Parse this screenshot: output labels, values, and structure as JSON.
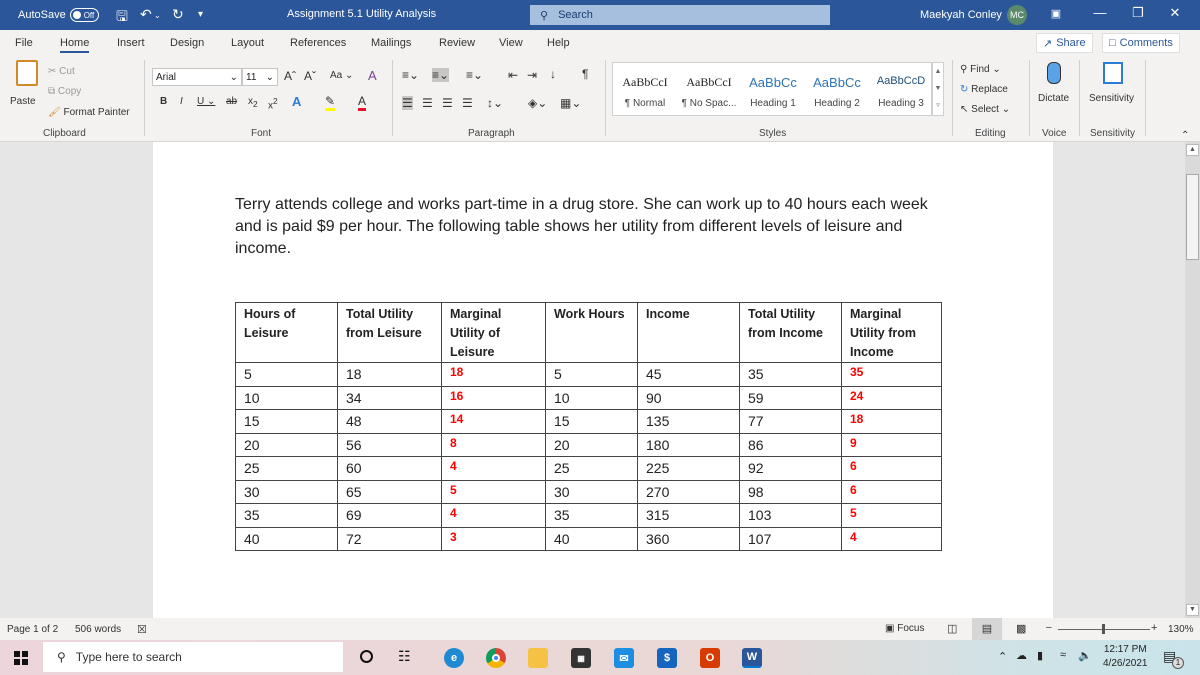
{
  "titlebar": {
    "autosave_label": "AutoSave",
    "autosave_state": "Off",
    "doc_title": "Assignment 5.1 Utility Analysis",
    "search_placeholder": "Search",
    "user_name": "Maekyah Conley",
    "user_initials": "MC"
  },
  "menu": {
    "tabs": [
      "File",
      "Home",
      "Insert",
      "Design",
      "Layout",
      "References",
      "Mailings",
      "Review",
      "View",
      "Help"
    ],
    "active": "Home",
    "share_label": "Share",
    "comments_label": "Comments"
  },
  "ribbon": {
    "clipboard": {
      "paste": "Paste",
      "cut": "Cut",
      "copy": "Copy",
      "format_painter": "Format Painter",
      "group": "Clipboard"
    },
    "font": {
      "family": "Arial",
      "size": "11",
      "case_btn": "Aa",
      "group": "Font"
    },
    "paragraph": {
      "group": "Paragraph"
    },
    "styles": {
      "items": [
        {
          "sample": "AaBbCcI",
          "name": "¶ Normal"
        },
        {
          "sample": "AaBbCcI",
          "name": "¶ No Spac..."
        },
        {
          "sample": "AaBbCc",
          "name": "Heading 1"
        },
        {
          "sample": "AaBbCc",
          "name": "Heading 2"
        },
        {
          "sample": "AaBbCcD",
          "name": "Heading 3"
        }
      ],
      "group": "Styles"
    },
    "editing": {
      "find": "Find",
      "replace": "Replace",
      "select": "Select",
      "group": "Editing"
    },
    "voice": {
      "dictate": "Dictate",
      "group": "Voice"
    },
    "sensitivity": {
      "label": "Sensitivity",
      "group": "Sensitivity"
    }
  },
  "document": {
    "paragraph": "Terry attends college and works part-time in a drug store. She can work up to 40 hours each week and is paid $9 per hour. The following table shows her utility from different levels of leisure and income.",
    "table": {
      "headers": [
        "Hours of Leisure",
        "Total Utility from Leisure",
        "Marginal Utility of Leisure",
        "Work Hours",
        "Income",
        "Total Utility from Income",
        "Marginal Utility from Income"
      ],
      "rows": [
        [
          "5",
          "18",
          "18",
          "5",
          "45",
          "35",
          "35"
        ],
        [
          "10",
          "34",
          "16",
          "10",
          "90",
          "59",
          "24"
        ],
        [
          "15",
          "48",
          "14",
          "15",
          "135",
          "77",
          "18"
        ],
        [
          "20",
          "56",
          "8",
          "20",
          "180",
          "86",
          "9"
        ],
        [
          "25",
          "60",
          "4",
          "25",
          "225",
          "92",
          "6"
        ],
        [
          "30",
          "65",
          "5",
          "30",
          "270",
          "98",
          "6"
        ],
        [
          "35",
          "69",
          "4",
          "35",
          "315",
          "103",
          "5"
        ],
        [
          "40",
          "72",
          "3",
          "40",
          "360",
          "107",
          "4"
        ]
      ]
    },
    "answer_color": "#ff0000"
  },
  "statusbar": {
    "page": "Page 1 of 2",
    "words": "506 words",
    "focus": "Focus",
    "zoom": "130%"
  },
  "taskbar": {
    "search_placeholder": "Type here to search",
    "time": "12:17 PM",
    "date": "4/26/2021",
    "notification_count": "1"
  }
}
